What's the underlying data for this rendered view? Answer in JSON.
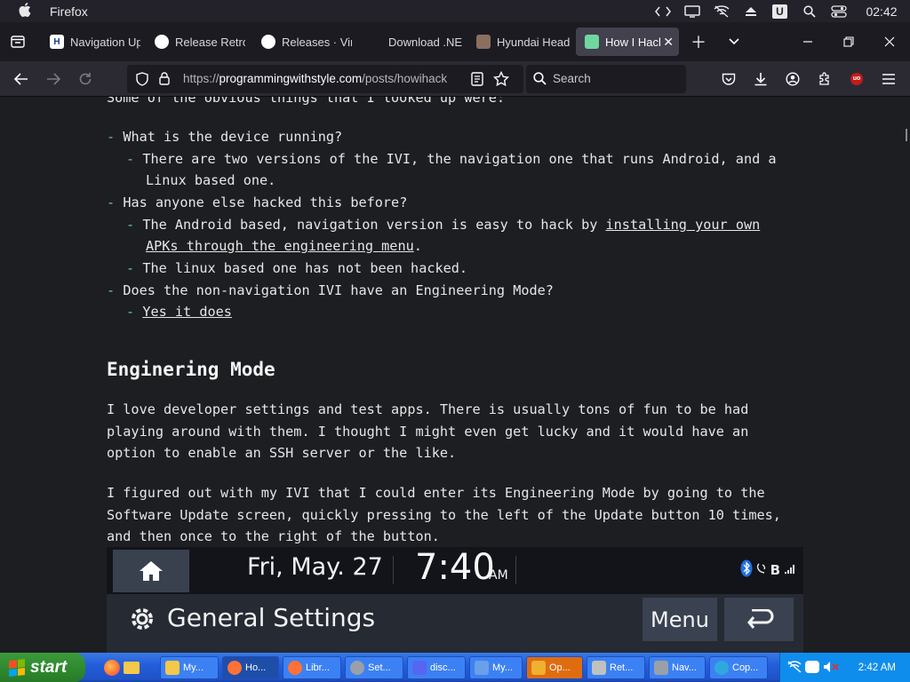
{
  "menubar": {
    "app_name": "Firefox",
    "clock": "02:42"
  },
  "browser": {
    "tabs": [
      {
        "title": "Navigation Up",
        "color": "#ffffff"
      },
      {
        "title": "Release RetroE",
        "color": "#ffffff"
      },
      {
        "title": "Releases · VinA",
        "color": "#ffffff"
      },
      {
        "title": "Download .NE",
        "color": "#1c1b22"
      },
      {
        "title": "Hyundai Head",
        "color": "#8a6f5f"
      },
      {
        "title": "How I Hack",
        "color": "#6fd8a0",
        "active": true
      }
    ],
    "url_prefix": "https://",
    "url_host": "programmingwithstyle.com",
    "url_path": "/posts/howihack",
    "search_placeholder": "Search"
  },
  "article": {
    "top_line": "Some of the obvious things that I looked up were:",
    "bullets": [
      {
        "text": "What is the device running?"
      },
      {
        "text": "There are two versions of the IVI, the navigation one that runs Android, and a",
        "cont": "Linux based one."
      },
      {
        "text": "Has anyone else hacked this before?"
      },
      {
        "text": "The Android based, navigation version is easy to hack by ",
        "link": "installing your own",
        "cont_link": "APKs through the engineering menu",
        "cont_after": "."
      },
      {
        "text": "The linux based one has not been hacked."
      },
      {
        "text": "Does the non-navigation IVI have an Engineering Mode?"
      },
      {
        "link": "Yes it does"
      }
    ],
    "heading": "Enginering Mode",
    "para1": [
      "I love developer settings and test apps. There is usually tons of fun to be had",
      "playing around with them. I thought I might even get lucky and it would have an",
      "option to enable an SSH server or the like."
    ],
    "para2": [
      "I figured out with my IVI that I could enter its Engineering Mode by going to the",
      "Software Update screen, quickly pressing to the left of the Update button 10 times,",
      "and then once to the right of the button."
    ],
    "dash": "-"
  },
  "ivi": {
    "date": "Fri, May. 27",
    "time": "7:40",
    "ampm": "AM",
    "status_text": "B",
    "title": "General Settings",
    "menu": "Menu"
  },
  "taskbar": {
    "start": "start",
    "items": [
      {
        "label": "My...",
        "color": "#f4c84a"
      },
      {
        "label": "Ho...",
        "color": "#ff7139"
      },
      {
        "label": "Libr...",
        "color": "#ff7139"
      },
      {
        "label": "Set...",
        "color": "#9aa0a8"
      },
      {
        "label": "disc...",
        "color": "#5865f2"
      },
      {
        "label": "My...",
        "color": "#6aa0e8"
      },
      {
        "label": "Op...",
        "color": "#f0b030"
      },
      {
        "label": "Ret...",
        "color": "#c0c0c0"
      },
      {
        "label": "Nav...",
        "color": "#9aa0a8"
      },
      {
        "label": "Cop...",
        "color": "#2fa8e0"
      }
    ],
    "clock": "2:42 AM"
  }
}
